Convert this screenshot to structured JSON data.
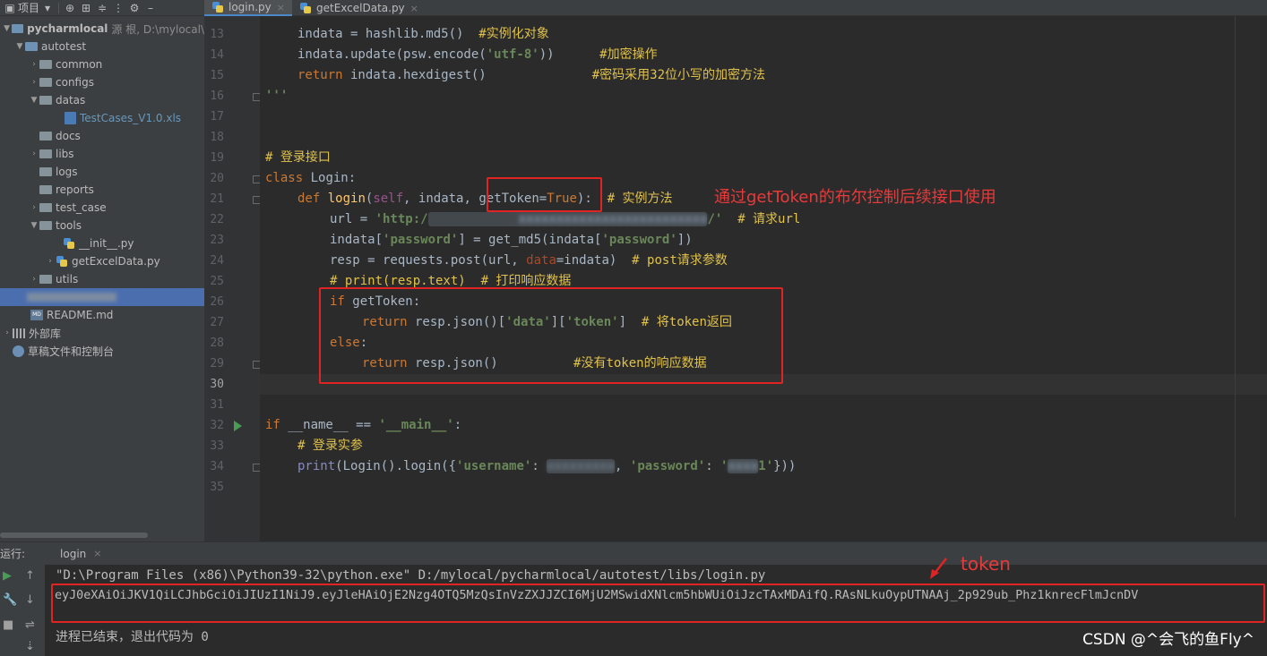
{
  "project_panel": {
    "header_label": "项目",
    "items": [
      {
        "label": "pycharmlocal",
        "extra": "源 根, D:\\mylocal\\"
      },
      {
        "label": "autotest"
      },
      {
        "label": "common"
      },
      {
        "label": "configs"
      },
      {
        "label": "datas"
      },
      {
        "label": "TestCases_V1.0.xls"
      },
      {
        "label": "docs"
      },
      {
        "label": "libs"
      },
      {
        "label": "logs"
      },
      {
        "label": "reports"
      },
      {
        "label": "test_case"
      },
      {
        "label": "tools"
      },
      {
        "label": "__init__.py"
      },
      {
        "label": "getExcelData.py"
      },
      {
        "label": "utils"
      },
      {
        "label": ""
      },
      {
        "label": "README.md"
      },
      {
        "label": "外部库"
      },
      {
        "label": "草稿文件和控制台"
      }
    ]
  },
  "tabs": [
    {
      "label": "login.py"
    },
    {
      "label": "getExcelData.py"
    }
  ],
  "line_numbers": [
    "13",
    "14",
    "15",
    "16",
    "17",
    "18",
    "19",
    "20",
    "21",
    "22",
    "23",
    "24",
    "25",
    "26",
    "27",
    "28",
    "29",
    "30",
    "31",
    "32",
    "33",
    "34",
    "35"
  ],
  "annotations": {
    "gettoken_note": "通过getToken的布尔控制后续接口使用",
    "token_note": "token"
  },
  "run_panel": {
    "label": "运行:",
    "tab": "login",
    "command": "\"D:\\Program Files (x86)\\Python39-32\\python.exe\" D:/mylocal/pycharmlocal/autotest/libs/login.py",
    "token": "eyJ0eXAiOiJKV1QiLCJhbGciOiJIUzI1NiJ9.eyJleHAiOjE2Nzg4OTQ5MzQsInVzZXJJZCI6MjU2MSwidXNlcm5hbWUiOiJzcTAxMDAifQ.RAsNLkuOypUTNAAj_2p929ub_Phz1knrecFlmJcnDV",
    "exit_message": "进程已结束，退出代码为 0"
  },
  "watermark": "CSDN @^会飞的鱼Fly^"
}
